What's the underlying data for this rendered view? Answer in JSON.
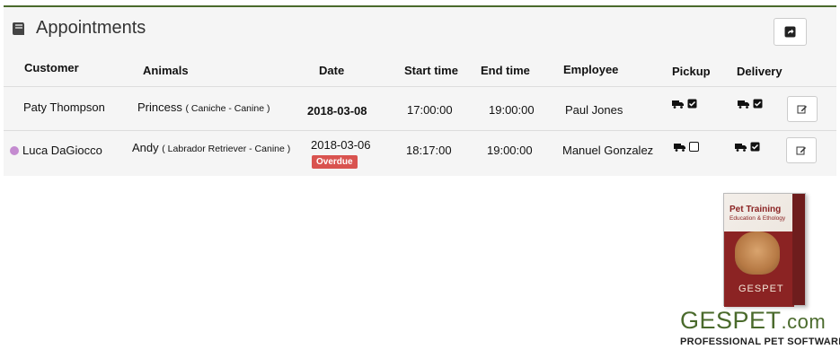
{
  "panel": {
    "title": "Appointments"
  },
  "columns": {
    "customer": "Customer",
    "animals": "Animals",
    "date": "Date",
    "start_time": "Start time",
    "end_time": "End time",
    "employee": "Employee",
    "pickup": "Pickup",
    "delivery": "Delivery"
  },
  "rows": [
    {
      "customer": "Paty Thompson",
      "animal_name": "Princess",
      "animal_detail": "( Caniche - Canine )",
      "date": "2018-03-08",
      "start_time": "17:00:00",
      "end_time": "19:00:00",
      "employee": "Paul Jones",
      "pickup_checked": true,
      "delivery_checked": true
    },
    {
      "customer": "Luca DaGiocco",
      "animal_name": "Andy",
      "animal_detail": "( Labrador Retriever - Canine )",
      "date": "2018-03-06",
      "badge": "Overdue",
      "start_time": "18:17:00",
      "end_time": "19:00:00",
      "employee": "Manuel Gonzalez",
      "pickup_checked": false,
      "delivery_checked": true
    }
  ],
  "ad": {
    "box_title": "Pet Training",
    "box_subtitle": "Education & Ethology",
    "box_brand": "GESPET",
    "brand_main": "GESPET",
    "brand_suffix": ".com",
    "brand_tagline": "PROFESSIONAL PET SOFTWARE"
  },
  "colors": {
    "accent": "#4a6a2c",
    "overdue": "#d9534f",
    "status_dot": "#c48bd0"
  }
}
